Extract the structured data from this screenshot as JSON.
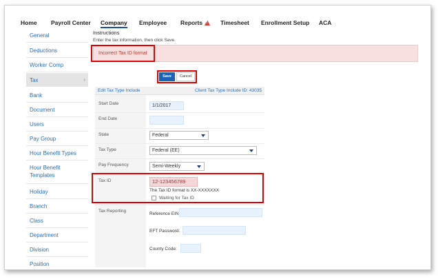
{
  "nav": {
    "items": [
      {
        "label": "Home"
      },
      {
        "label": "Payroll Center"
      },
      {
        "label": "Company"
      },
      {
        "label": "Employee"
      },
      {
        "label": "Reports"
      },
      {
        "label": "Timesheet"
      },
      {
        "label": "Enrollment Setup"
      },
      {
        "label": "ACA"
      }
    ]
  },
  "sidebar": {
    "items": [
      {
        "label": "General"
      },
      {
        "label": "Deductions"
      },
      {
        "label": "Worker Comp"
      },
      {
        "label": "Tax"
      },
      {
        "label": "Bank"
      },
      {
        "label": "Document"
      },
      {
        "label": "Users"
      },
      {
        "label": "Pay Group"
      },
      {
        "label": "Hour Benefit Types"
      },
      {
        "label": "Hour Benefit Templates"
      },
      {
        "label": "Holiday"
      },
      {
        "label": "Branch"
      },
      {
        "label": "Class"
      },
      {
        "label": "Department"
      },
      {
        "label": "Division"
      },
      {
        "label": "Position"
      }
    ],
    "active_chevron": "›"
  },
  "main": {
    "instructions_title": "Instructions",
    "instructions_text": "Enter the tax information, then click Save.",
    "error_text": "Incorrect Tax ID format",
    "save_label": "Save",
    "cancel_label": "Cancel",
    "form": {
      "header_left": "Edit Tax Type Include",
      "header_right": "Client Tax Type Include ID: 43035",
      "start_date_label": "Start Date",
      "start_date_value": "1/1/2017",
      "end_date_label": "End Date",
      "end_date_value": "",
      "state_label": "State",
      "state_value": "Federal",
      "tax_type_label": "Tax Type",
      "tax_type_value": "Federal (EE)",
      "pay_frequency_label": "Pay Frequency",
      "pay_frequency_value": "Semi-Weekly",
      "tax_id_label": "Tax ID",
      "tax_id_value": "12-123456789",
      "tax_id_hint": "The Tax ID format is XX-XXXXXXX",
      "waiting_label": "Waiting for Tax ID",
      "tax_reporting_label": "Tax Reporting",
      "reference_ein_label": "Reference EIN:",
      "eft_password_label": "EFT Password:",
      "county_code_label": "County Code:"
    }
  },
  "colors": {
    "accent": "#1a63b8",
    "link": "#2a6ebb",
    "error_border": "#e00000",
    "error_bg": "#f8dfe0"
  }
}
